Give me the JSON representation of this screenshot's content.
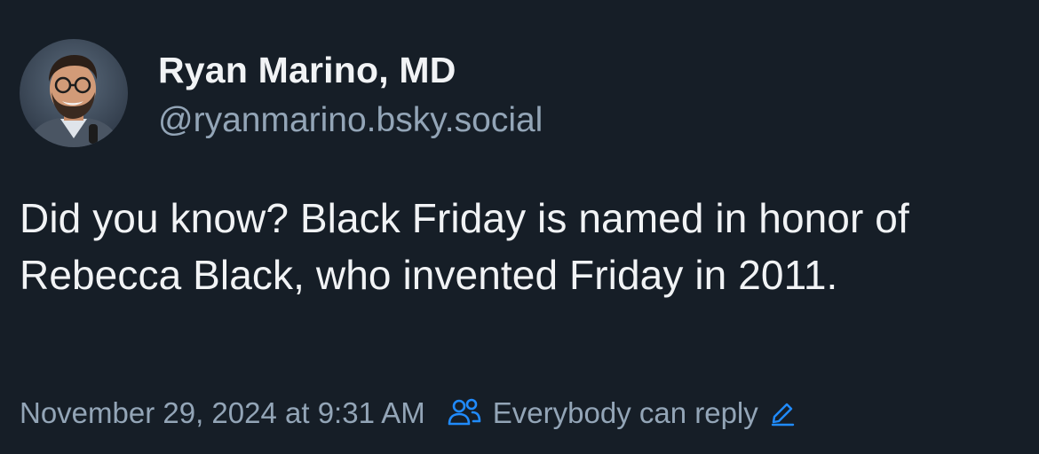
{
  "post": {
    "author": {
      "display_name": "Ryan Marino, MD",
      "handle": "@ryanmarino.bsky.social"
    },
    "text": "Did you know? Black Friday is named in honor of Rebecca Black, who invented Friday in 2011.",
    "timestamp": "November 29, 2024 at 9:31 AM",
    "reply_setting": "Everybody can reply"
  },
  "icons": {
    "people": "people-icon",
    "edit": "pencil-icon",
    "avatar": "avatar"
  },
  "colors": {
    "background": "#161e27",
    "text_primary": "#f1f3f5",
    "text_secondary": "#93a5b7",
    "accent": "#208bfe"
  }
}
